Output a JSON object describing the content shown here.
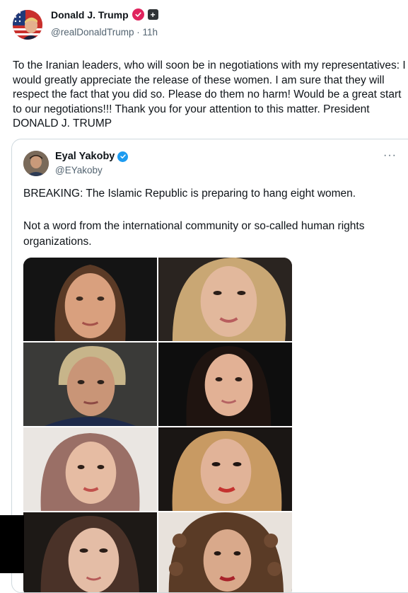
{
  "post": {
    "author_name": "Donald J. Trump",
    "handle": "@realDonaldTrump",
    "separator": "·",
    "time": "11h",
    "text": "To the Iranian leaders, who will soon be in negotiations with my representatives: I would greatly appreciate the release of these women. I am sure that they will respect the fact that you did so. Please do them no harm! Would be a great start to our negotiations!!! Thank you for your attention to this matter. President DONALD J. TRUMP"
  },
  "quote": {
    "author_name": "Eyal Yakoby",
    "handle": "@EYakoby",
    "more_label": "···",
    "paragraph1": "BREAKING: The Islamic Republic is preparing to hang eight women.",
    "paragraph2": "Not a word from the international community or so-called human rights organizations."
  },
  "colors": {
    "verified_red": "#e0245e",
    "verified_blue": "#1d9bf0",
    "secondary_text": "#536471",
    "card_border": "#cfd9de"
  },
  "icons": [
    "verified-badge-icon",
    "plus-badge-icon",
    "more-options-icon"
  ]
}
